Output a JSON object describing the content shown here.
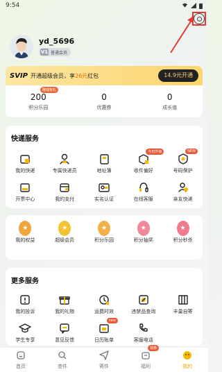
{
  "status_bar": {
    "time": "9:54"
  },
  "user": {
    "name": "yd_5696",
    "level_badge": "V1",
    "level_label": "普通会员"
  },
  "svip": {
    "logo": "SVIP",
    "text_prefix": "开通超级会员，享",
    "highlight": "26元",
    "text_suffix": "红包",
    "button": "14.9元开通"
  },
  "stats": [
    {
      "value": "200",
      "label": "积分乐园",
      "tag": "赚钱有礼"
    },
    {
      "value": "0",
      "label": "优惠券",
      "tag": ""
    },
    {
      "value": "0",
      "label": "成长值",
      "tag": ""
    }
  ],
  "express": {
    "title": "快递服务",
    "items": [
      {
        "label": "我的快递",
        "icon": "package-icon",
        "tag": ""
      },
      {
        "label": "专属快递员",
        "icon": "courier-icon",
        "tag": ""
      },
      {
        "label": "地址簿",
        "icon": "address-book-icon",
        "tag": ""
      },
      {
        "label": "收件偏好",
        "icon": "preference-icon",
        "tag": "今日升级"
      },
      {
        "label": "号码保护",
        "icon": "shield-icon",
        "tag": "NEW"
      },
      {
        "label": "开票中心",
        "icon": "invoice-icon",
        "tag": ""
      },
      {
        "label": "我的支付",
        "icon": "wallet-icon",
        "tag": ""
      },
      {
        "label": "实名认证",
        "icon": "id-card-icon",
        "tag": ""
      },
      {
        "label": "在线客服",
        "icon": "headset-icon",
        "tag": ""
      },
      {
        "label": "亲友快递",
        "icon": "friends-icon",
        "tag": ""
      }
    ]
  },
  "benefits": [
    {
      "label": "我的权益",
      "icon": "rights-icon",
      "color": "#f0a63c"
    },
    {
      "label": "超级会员",
      "icon": "vip-crown-icon",
      "color": "#f4c232"
    },
    {
      "label": "积分乐园",
      "icon": "points-icon",
      "color": "#f2b048"
    },
    {
      "label": "积分抽奖",
      "icon": "lottery-icon",
      "color": "#f08a9a"
    },
    {
      "label": "积分秒杀",
      "icon": "flash-sale-icon",
      "color": "#ee7c8c"
    }
  ],
  "more": {
    "title": "更多服务",
    "items": [
      {
        "label": "我的投诉",
        "icon": "complaint-icon",
        "tag": ""
      },
      {
        "label": "我的礼物",
        "icon": "gift-icon",
        "tag": ""
      },
      {
        "label": "运费时效",
        "icon": "clock-icon",
        "tag": ""
      },
      {
        "label": "违禁品查询",
        "icon": "prohibited-icon",
        "tag": ""
      },
      {
        "label": "丰巢自寄",
        "icon": "locker-icon",
        "tag": ""
      },
      {
        "label": "学生专享",
        "icon": "student-icon",
        "tag": ""
      },
      {
        "label": "意见反馈",
        "icon": "feedback-icon",
        "tag": ""
      },
      {
        "label": "日历账单",
        "icon": "calendar-icon",
        "tag": "new"
      },
      {
        "label": "客服电话",
        "icon": "phone-icon",
        "tag": ""
      }
    ]
  },
  "tabbar": [
    {
      "label": "首页",
      "icon": "home-icon",
      "tag": "",
      "active": false
    },
    {
      "label": "查件",
      "icon": "search-icon",
      "tag": "",
      "active": false
    },
    {
      "label": "寄件",
      "icon": "send-icon",
      "tag": "",
      "active": false
    },
    {
      "label": "福利",
      "icon": "welfare-icon",
      "tag": "领券",
      "active": false
    },
    {
      "label": "我的",
      "icon": "mine-icon",
      "tag": "",
      "active": true
    }
  ],
  "colors": {
    "accent": "#f5b800",
    "annotation": "#e53935"
  }
}
